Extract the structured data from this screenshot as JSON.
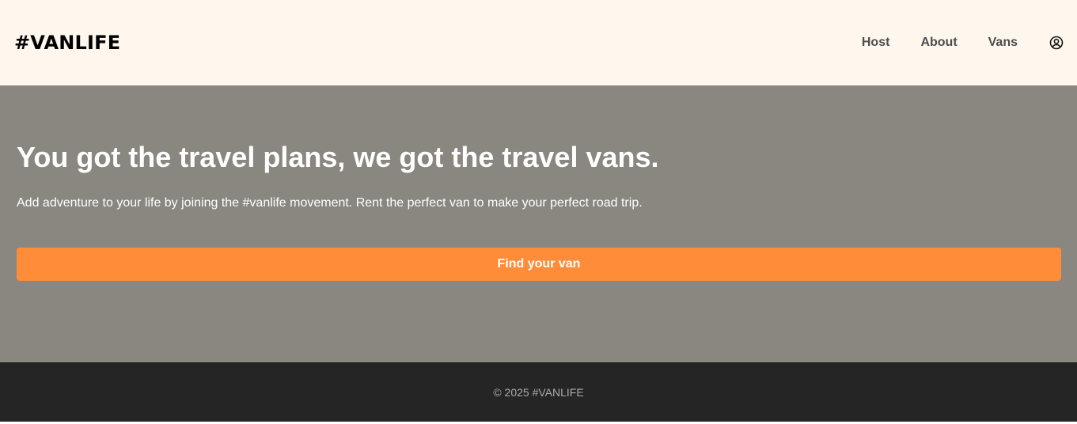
{
  "header": {
    "logo": "#VANLIFE",
    "nav": {
      "host": "Host",
      "about": "About",
      "vans": "Vans"
    },
    "user_icon": "user-circle-icon"
  },
  "hero": {
    "title": "You got the travel plans, we got the travel vans.",
    "subtitle": "Add adventure to your life by joining the #vanlife movement. Rent the perfect van to make your perfect road trip.",
    "cta_label": "Find your van"
  },
  "footer": {
    "copyright": "© 2025 #VANLIFE"
  },
  "colors": {
    "header_bg": "#fff7ed",
    "hero_bg": "#8a8781",
    "cta_bg": "#ff8c38",
    "footer_bg": "#252525",
    "nav_text": "#4d4d4d"
  }
}
